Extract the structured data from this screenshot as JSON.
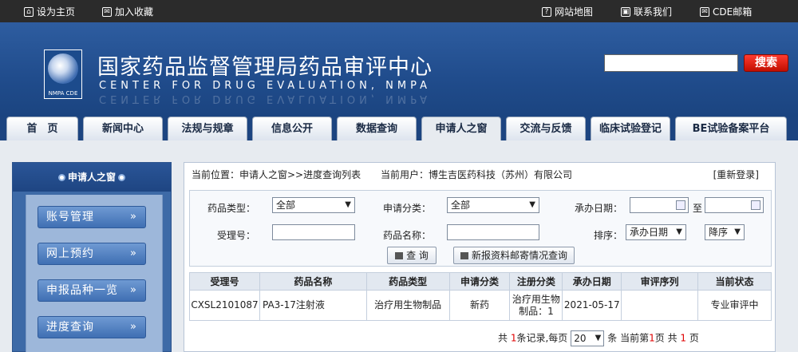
{
  "topbar": {
    "set_home": "设为主页",
    "bookmark": "加入收藏",
    "sitemap": "网站地图",
    "contact": "联系我们",
    "mail": "CDE邮箱"
  },
  "header": {
    "title_cn": "国家药品监督管理局药品审评中心",
    "title_en": "CENTER FOR DRUG EVALUATION, NMPA",
    "logo_text": "NMPA CDE",
    "search_button": "搜索",
    "search_value": ""
  },
  "nav": [
    "首　页",
    "新闻中心",
    "法规与规章",
    "信息公开",
    "数据查询",
    "申请人之窗",
    "交流与反馈",
    "临床试验登记",
    "BE试验备案平台"
  ],
  "side": {
    "title": "申请人之窗",
    "items": [
      "账号管理",
      "网上预约",
      "申报品种一览",
      "进度查询"
    ]
  },
  "content": {
    "breadcrumb": "当前位置：申请人之窗>>进度查询列表",
    "current_user": "当前用户：博生吉医药科技（苏州）有限公司",
    "relogin": "[重新登录]",
    "filter": {
      "drug_type_label": "药品类型：",
      "drug_type_value": "全部",
      "apply_class_label": "申请分类：",
      "apply_class_value": "全部",
      "date_label": "承办日期：",
      "to_label": "至",
      "accept_no_label": "受理号：",
      "drug_name_label": "药品名称：",
      "sort_label": "排序：",
      "sort_field_value": "承办日期",
      "sort_order_value": "降序",
      "query_button": "查 询",
      "mail_query_button": "新报资料邮寄情况查询"
    },
    "table": {
      "headers": [
        "受理号",
        "药品名称",
        "药品类型",
        "申请分类",
        "注册分类",
        "承办日期",
        "审评序列",
        "当前状态"
      ],
      "rows": [
        [
          "CXSL2101087",
          "PA3-17注射液",
          "治疗用生物制品",
          "新药",
          "治疗用生物制品：1",
          "2021-05-17",
          "",
          "专业审评中"
        ]
      ]
    },
    "pager": {
      "prefix": "共 ",
      "total": "1",
      "mid1": "条记录,每页",
      "per_page": "20",
      "mid2": "条 当前第",
      "current": "1",
      "mid3": "页 共 ",
      "pages": "1",
      "suffix": " 页"
    }
  }
}
